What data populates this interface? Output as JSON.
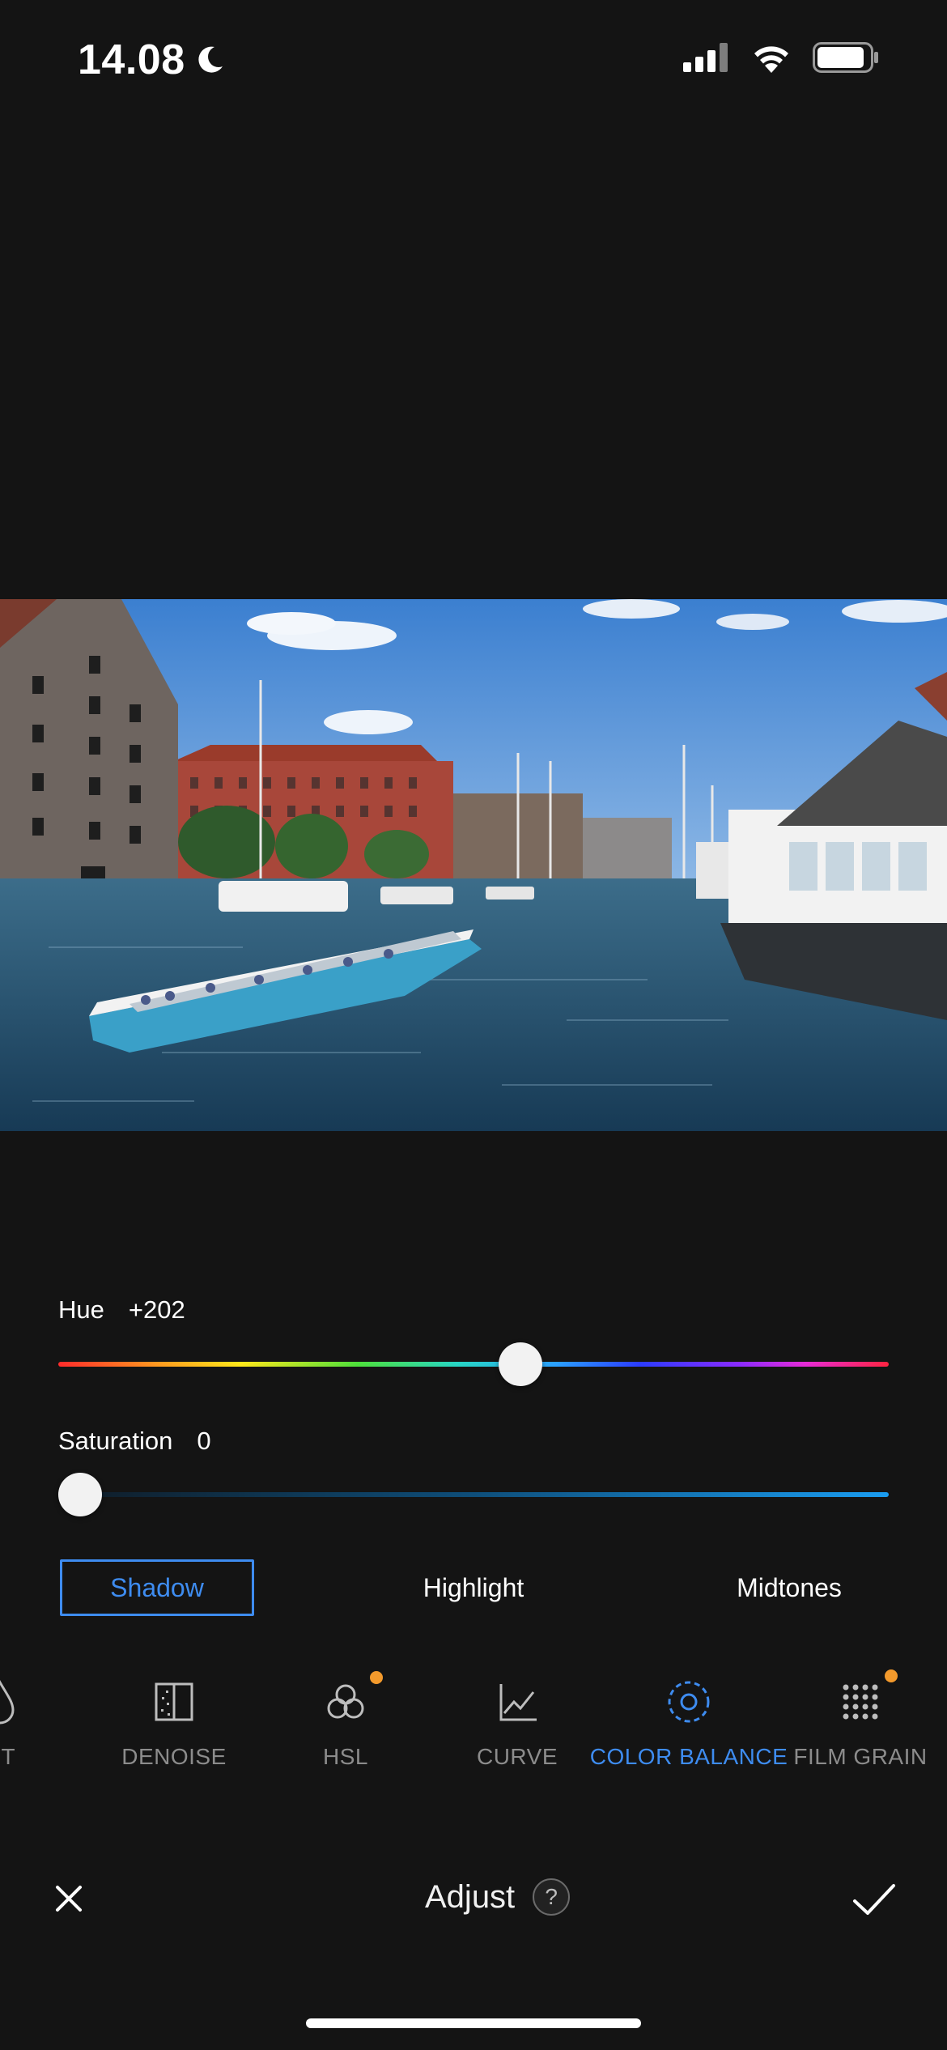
{
  "status_bar": {
    "time": "14.08",
    "battery_level": 0.9
  },
  "sliders": {
    "hue": {
      "label": "Hue",
      "value_text": "+202",
      "fraction": 0.56
    },
    "saturation": {
      "label": "Saturation",
      "value_text": "0",
      "fraction": 0.0
    }
  },
  "tone_tabs": [
    {
      "label": "Shadow",
      "active": true
    },
    {
      "label": "Highlight",
      "active": false
    },
    {
      "label": "Midtones",
      "active": false
    }
  ],
  "tools": [
    {
      "label": "NT",
      "icon": "drop-icon",
      "dot": false,
      "active": false
    },
    {
      "label": "DENOISE",
      "icon": "denoise-icon",
      "dot": false,
      "active": false
    },
    {
      "label": "HSL",
      "icon": "hsl-icon",
      "dot": true,
      "active": false
    },
    {
      "label": "CURVE",
      "icon": "curve-icon",
      "dot": false,
      "active": false
    },
    {
      "label": "COLOR BALANCE",
      "icon": "color-balance-icon",
      "dot": false,
      "active": true
    },
    {
      "label": "FILM GRAIN",
      "icon": "film-grain-icon",
      "dot": true,
      "active": false
    }
  ],
  "bottom_bar": {
    "title": "Adjust",
    "help": "?"
  },
  "colors": {
    "accent": "#3e8cf0",
    "dot": "#f39a2c",
    "background": "#141414"
  }
}
